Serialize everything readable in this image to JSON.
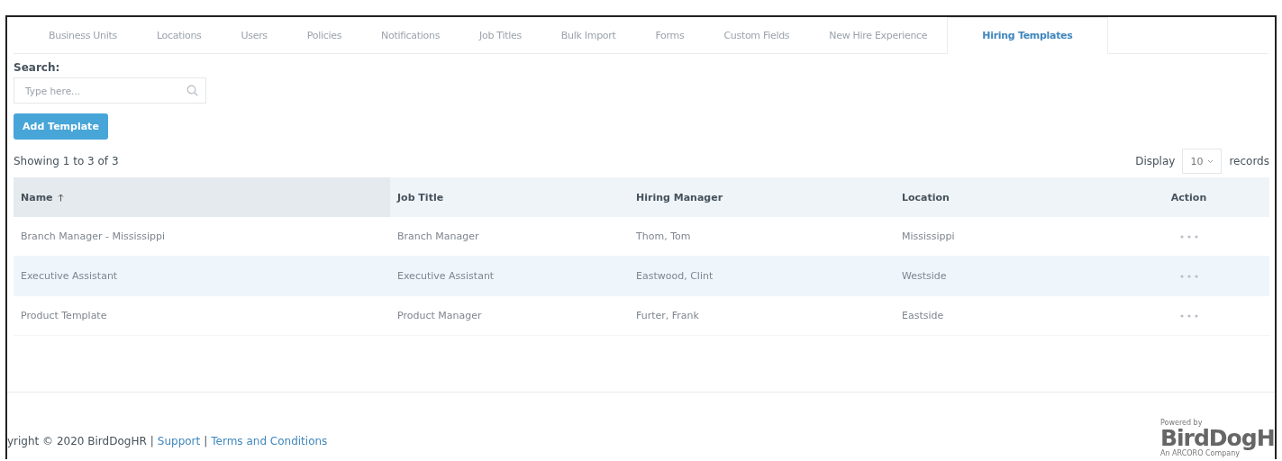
{
  "tabs": [
    {
      "label": "Business Units",
      "selected": false
    },
    {
      "label": "Locations",
      "selected": false
    },
    {
      "label": "Users",
      "selected": false
    },
    {
      "label": "Policies",
      "selected": false
    },
    {
      "label": "Notifications",
      "selected": false
    },
    {
      "label": "Job Titles",
      "selected": false
    },
    {
      "label": "Bulk Import",
      "selected": false
    },
    {
      "label": "Forms",
      "selected": false
    },
    {
      "label": "Custom Fields",
      "selected": false
    },
    {
      "label": "New Hire Experience",
      "selected": false
    },
    {
      "label": "Hiring Templates",
      "selected": true
    }
  ],
  "search": {
    "label": "Search:",
    "placeholder": "Type here..."
  },
  "add_button": "Add Template",
  "summary": "Showing 1 to 3 of 3",
  "page_size": {
    "before": "Display",
    "value": "10",
    "after": "records"
  },
  "table": {
    "columns": [
      {
        "label": "Name",
        "sorted": true
      },
      {
        "label": "Job Title",
        "sorted": false
      },
      {
        "label": "Hiring Manager",
        "sorted": false
      },
      {
        "label": "Location",
        "sorted": false
      },
      {
        "label": "Action",
        "sorted": false
      }
    ],
    "rows": [
      {
        "cells": [
          "Branch Manager - Mississippi",
          "Branch Manager",
          "Thom, Tom",
          "Mississippi"
        ],
        "highlighted": false
      },
      {
        "cells": [
          "Executive Assistant",
          "Executive Assistant",
          "Eastwood, Clint",
          "Westside"
        ],
        "highlighted": true
      },
      {
        "cells": [
          "Product Template",
          "Product Manager",
          "Furter, Frank",
          "Eastside"
        ],
        "highlighted": false
      }
    ]
  },
  "footer": {
    "copyright": "yright © 2020 BirdDogHR",
    "links": [
      "Support",
      "Terms and Conditions"
    ],
    "separator": "|"
  },
  "logo": {
    "tagline_top": "Powered by",
    "name": "BirdDogH",
    "tagline_bottom": "An ARCORO Company"
  }
}
